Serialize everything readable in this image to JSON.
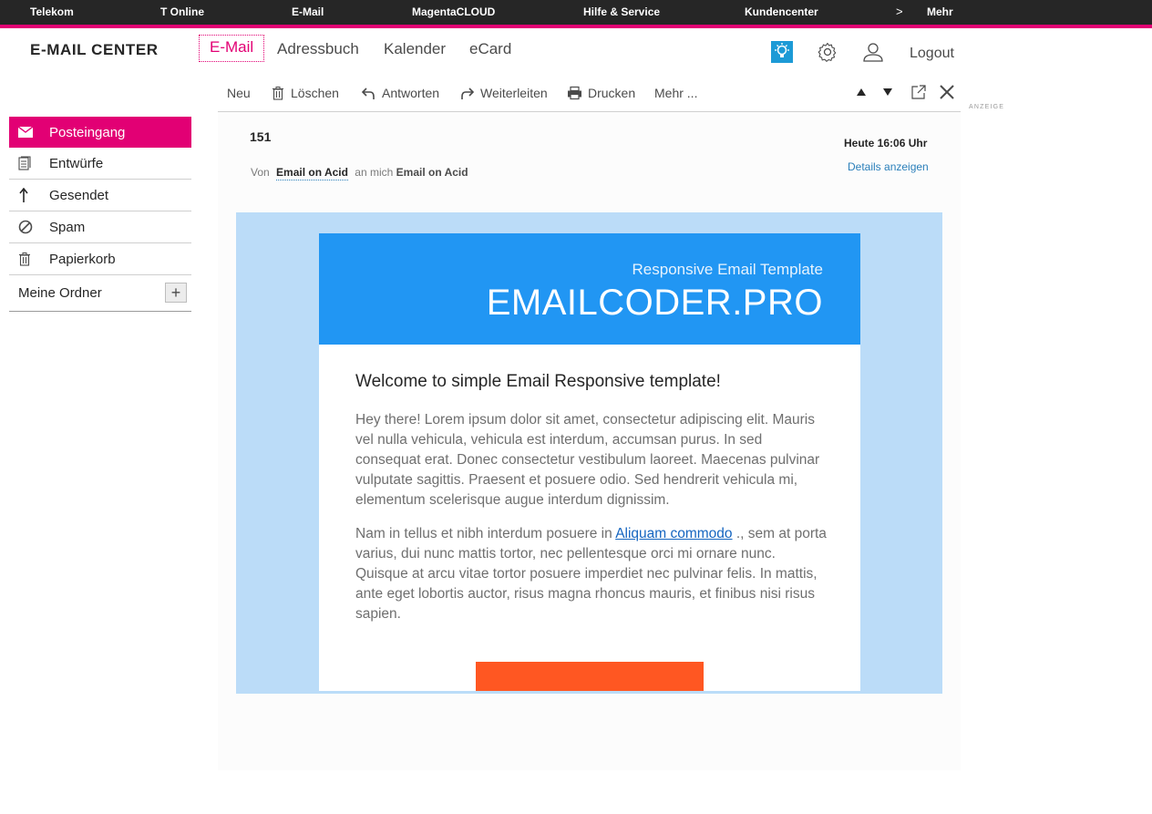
{
  "topnav": {
    "items": [
      "Telekom",
      "T Online",
      "E-Mail",
      "MagentaCLOUD",
      "Hilfe & Service",
      "Kundencenter"
    ],
    "more_chevron": ">",
    "more_label": "Mehr"
  },
  "header": {
    "brand": "E-MAIL CENTER",
    "tabs": [
      "E-Mail",
      "Adressbuch",
      "Kalender",
      "eCard"
    ],
    "active_tab": "E-Mail",
    "icons": [
      "lightbulb-icon",
      "gear-icon",
      "user-icon"
    ],
    "logout": "Logout"
  },
  "toolbar": {
    "new": "Neu",
    "delete": "Löschen",
    "reply": "Antworten",
    "forward": "Weiterleiten",
    "print": "Drucken",
    "more": "Mehr ..."
  },
  "ad_label": "ANZEIGE",
  "sidebar": {
    "folders": [
      {
        "label": "Posteingang",
        "icon": "envelope-icon",
        "active": true
      },
      {
        "label": "Entwürfe",
        "icon": "draft-icon",
        "active": false
      },
      {
        "label": "Gesendet",
        "icon": "arrow-up-icon",
        "active": false
      },
      {
        "label": "Spam",
        "icon": "block-icon",
        "active": false
      },
      {
        "label": "Papierkorb",
        "icon": "trash-icon",
        "active": false
      }
    ],
    "my_folders": "Meine Ordner",
    "add_label": "+"
  },
  "message": {
    "subject": "151",
    "date": "Heute 16:06 Uhr",
    "details_link": "Details anzeigen",
    "from_prefix": "Von",
    "from_name": "Email on Acid",
    "to_prefix": "an mich",
    "to_name": "Email on Acid"
  },
  "email": {
    "header_sub": "Responsive Email Template",
    "header_title": "EMAILCODER.PRO",
    "heading": "Welcome to simple Email Responsive template!",
    "p1": "Hey there! Lorem ipsum dolor sit amet, consectetur adipiscing elit. Mauris vel nulla vehicula, vehicula est interdum, accumsan purus. In sed consequat erat. Donec consectetur vestibulum laoreet. Maecenas pulvinar vulputate sagittis. Praesent et posuere odio. Sed hendrerit vehicula mi, elementum scelerisque augue interdum dignissim.",
    "p2_before": "Nam in tellus et nibh interdum posuere in ",
    "p2_link": "Aliquam commodo",
    "p2_after": " ., sem at porta varius, dui nunc mattis tortor, nec pellentesque orci mi ornare nunc. Quisque at arcu vitae tortor posuere imperdiet nec pulvinar felis. In mattis, ante eget lobortis auctor, risus magna rhoncus mauris, et finibus nisi risus sapien."
  },
  "colors": {
    "magenta": "#e20074",
    "email_header": "#2196f3",
    "email_background": "#bbdcf8",
    "cta": "#ff5722"
  }
}
